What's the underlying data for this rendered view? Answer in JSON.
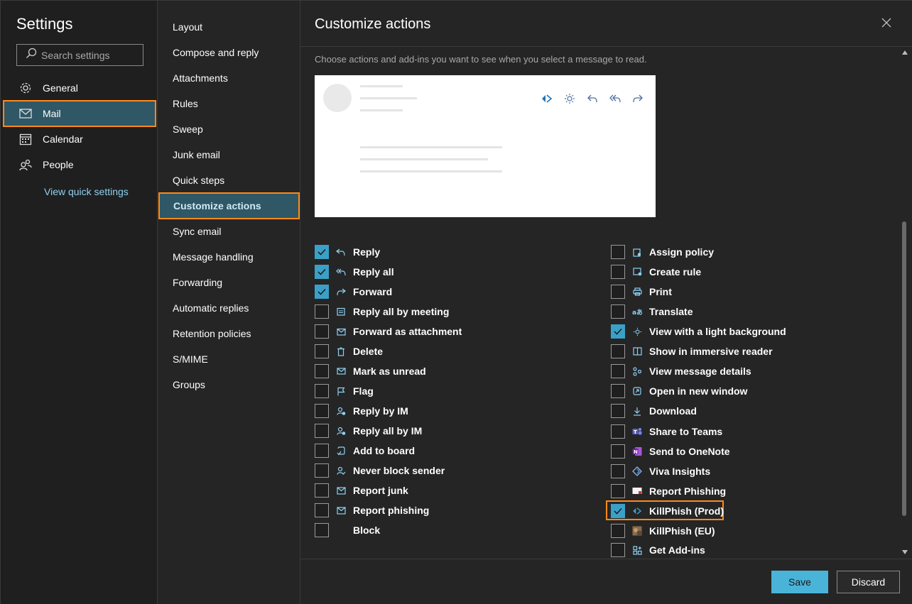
{
  "sidebar": {
    "title": "Settings",
    "search_placeholder": "Search settings",
    "items": [
      {
        "label": "General",
        "icon": "gear-icon"
      },
      {
        "label": "Mail",
        "icon": "mail-icon",
        "selected": true
      },
      {
        "label": "Calendar",
        "icon": "calendar-icon"
      },
      {
        "label": "People",
        "icon": "people-icon"
      }
    ],
    "quick_settings_link": "View quick settings"
  },
  "mail_menu": {
    "items": [
      "Layout",
      "Compose and reply",
      "Attachments",
      "Rules",
      "Sweep",
      "Junk email",
      "Quick steps",
      "Customize actions",
      "Sync email",
      "Message handling",
      "Forwarding",
      "Automatic replies",
      "Retention policies",
      "S/MIME",
      "Groups"
    ],
    "selected_index": 7
  },
  "panel": {
    "title": "Customize actions",
    "description": "Choose actions and add-ins you want to see when you select a message to read.",
    "left_options": [
      {
        "label": "Reply",
        "checked": true,
        "icon": "reply-icon"
      },
      {
        "label": "Reply all",
        "checked": true,
        "icon": "reply-all-icon"
      },
      {
        "label": "Forward",
        "checked": true,
        "icon": "forward-icon"
      },
      {
        "label": "Reply all by meeting",
        "checked": false,
        "icon": "meeting-icon"
      },
      {
        "label": "Forward as attachment",
        "checked": false,
        "icon": "forward-attachment-icon"
      },
      {
        "label": "Delete",
        "checked": false,
        "icon": "trash-icon"
      },
      {
        "label": "Mark as unread",
        "checked": false,
        "icon": "envelope-icon"
      },
      {
        "label": "Flag",
        "checked": false,
        "icon": "flag-icon"
      },
      {
        "label": "Reply by IM",
        "checked": false,
        "icon": "im-icon"
      },
      {
        "label": "Reply all by IM",
        "checked": false,
        "icon": "im-all-icon"
      },
      {
        "label": "Add to board",
        "checked": false,
        "icon": "board-icon"
      },
      {
        "label": "Never block sender",
        "checked": false,
        "icon": "person-check-icon"
      },
      {
        "label": "Report junk",
        "checked": false,
        "icon": "junk-icon"
      },
      {
        "label": "Report phishing",
        "checked": false,
        "icon": "phishing-icon"
      },
      {
        "label": "Block",
        "checked": false,
        "icon": "block-icon"
      }
    ],
    "right_options": [
      {
        "label": "Assign policy",
        "checked": false,
        "icon": "policy-icon"
      },
      {
        "label": "Create rule",
        "checked": false,
        "icon": "rule-icon"
      },
      {
        "label": "Print",
        "checked": false,
        "icon": "print-icon"
      },
      {
        "label": "Translate",
        "checked": false,
        "icon": "translate-icon"
      },
      {
        "label": "View with a light background",
        "checked": true,
        "icon": "sun-icon"
      },
      {
        "label": "Show in immersive reader",
        "checked": false,
        "icon": "reader-icon"
      },
      {
        "label": "View message details",
        "checked": false,
        "icon": "details-icon"
      },
      {
        "label": "Open in new window",
        "checked": false,
        "icon": "new-window-icon"
      },
      {
        "label": "Download",
        "checked": false,
        "icon": "download-icon"
      },
      {
        "label": "Share to Teams",
        "checked": false,
        "icon": "teams-icon"
      },
      {
        "label": "Send to OneNote",
        "checked": false,
        "icon": "onenote-icon"
      },
      {
        "label": "Viva Insights",
        "checked": false,
        "icon": "viva-icon"
      },
      {
        "label": "Report Phishing",
        "checked": false,
        "icon": "report-phishing-addin-icon"
      },
      {
        "label": "KillPhish (Prod)",
        "checked": true,
        "icon": "killphish-icon",
        "highlighted": true
      },
      {
        "label": "KillPhish (EU)",
        "checked": false,
        "icon": "killphish-eu-icon"
      },
      {
        "label": "Get Add-ins",
        "checked": false,
        "icon": "grid-plus-icon"
      }
    ]
  },
  "footer": {
    "save_label": "Save",
    "discard_label": "Discard"
  },
  "colors": {
    "accent": "#3aa0c8",
    "highlight": "#ff8a1a",
    "selected_bg": "#2f5765"
  }
}
